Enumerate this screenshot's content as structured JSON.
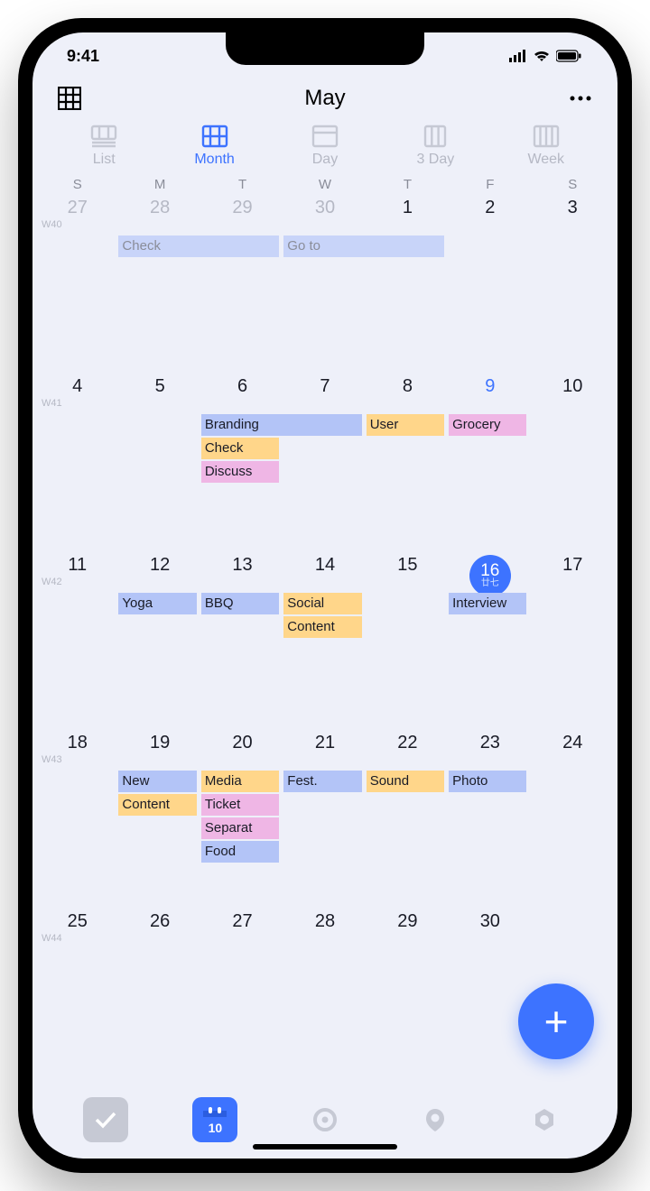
{
  "status": {
    "time": "9:41"
  },
  "header": {
    "title": "May"
  },
  "view_tabs": [
    {
      "label": "List",
      "active": false
    },
    {
      "label": "Month",
      "active": true
    },
    {
      "label": "Day",
      "active": false
    },
    {
      "label": "3 Day",
      "active": false
    },
    {
      "label": "Week",
      "active": false
    }
  ],
  "weekdays": [
    "S",
    "M",
    "T",
    "W",
    "T",
    "F",
    "S"
  ],
  "weeks": [
    {
      "wk": "W40",
      "dates": [
        {
          "num": "27",
          "dim": true
        },
        {
          "num": "28",
          "dim": true
        },
        {
          "num": "29",
          "dim": true
        },
        {
          "num": "30",
          "dim": true
        },
        {
          "num": "1"
        },
        {
          "num": "2"
        },
        {
          "num": "3"
        }
      ],
      "events": [
        {
          "label": "Check",
          "start": 1,
          "span": 2,
          "row": 0,
          "color": "lblue",
          "dim": true
        },
        {
          "label": "Go to",
          "start": 3,
          "span": 2,
          "row": 0,
          "color": "lblue",
          "dim": true
        }
      ]
    },
    {
      "wk": "W41",
      "dates": [
        {
          "num": "4"
        },
        {
          "num": "5"
        },
        {
          "num": "6"
        },
        {
          "num": "7"
        },
        {
          "num": "8"
        },
        {
          "num": "9",
          "today": true
        },
        {
          "num": "10"
        }
      ],
      "events": [
        {
          "label": "Branding",
          "start": 2,
          "span": 2,
          "row": 0,
          "color": "blue"
        },
        {
          "label": "User",
          "start": 4,
          "span": 1,
          "row": 0,
          "color": "yellow"
        },
        {
          "label": "Grocery",
          "start": 5,
          "span": 1,
          "row": 0,
          "color": "pink"
        },
        {
          "label": "Check",
          "start": 2,
          "span": 1,
          "row": 1,
          "color": "yellow"
        },
        {
          "label": "Discuss",
          "start": 2,
          "span": 1,
          "row": 2,
          "color": "pink"
        }
      ]
    },
    {
      "wk": "W42",
      "dates": [
        {
          "num": "11"
        },
        {
          "num": "12"
        },
        {
          "num": "13"
        },
        {
          "num": "14"
        },
        {
          "num": "15"
        },
        {
          "num": "16",
          "highlight": true,
          "sub": "廿七"
        },
        {
          "num": "17"
        }
      ],
      "events": [
        {
          "label": "Yoga",
          "start": 1,
          "span": 1,
          "row": 0,
          "color": "blue"
        },
        {
          "label": "BBQ",
          "start": 2,
          "span": 1,
          "row": 0,
          "color": "blue"
        },
        {
          "label": "Social",
          "start": 3,
          "span": 1,
          "row": 0,
          "color": "yellow"
        },
        {
          "label": "Interview",
          "start": 5,
          "span": 1,
          "row": 0,
          "color": "blue"
        },
        {
          "label": "Content",
          "start": 3,
          "span": 1,
          "row": 1,
          "color": "yellow"
        }
      ]
    },
    {
      "wk": "W43",
      "dates": [
        {
          "num": "18"
        },
        {
          "num": "19"
        },
        {
          "num": "20"
        },
        {
          "num": "21"
        },
        {
          "num": "22"
        },
        {
          "num": "23"
        },
        {
          "num": "24"
        }
      ],
      "events": [
        {
          "label": "New",
          "start": 1,
          "span": 1,
          "row": 0,
          "color": "blue"
        },
        {
          "label": "Media",
          "start": 2,
          "span": 1,
          "row": 0,
          "color": "yellow"
        },
        {
          "label": "Fest.",
          "start": 3,
          "span": 1,
          "row": 0,
          "color": "blue"
        },
        {
          "label": "Sound",
          "start": 4,
          "span": 1,
          "row": 0,
          "color": "yellow"
        },
        {
          "label": "Photo",
          "start": 5,
          "span": 1,
          "row": 0,
          "color": "blue"
        },
        {
          "label": "Content",
          "start": 1,
          "span": 1,
          "row": 1,
          "color": "yellow"
        },
        {
          "label": "Ticket",
          "start": 2,
          "span": 1,
          "row": 1,
          "color": "pink"
        },
        {
          "label": "Separat",
          "start": 2,
          "span": 1,
          "row": 2,
          "color": "pink"
        },
        {
          "label": "Food",
          "start": 2,
          "span": 1,
          "row": 3,
          "color": "blue"
        }
      ]
    },
    {
      "wk": "W44",
      "dates": [
        {
          "num": "25"
        },
        {
          "num": "26"
        },
        {
          "num": "27"
        },
        {
          "num": "28"
        },
        {
          "num": "29"
        },
        {
          "num": "30"
        },
        {
          "num": ""
        }
      ],
      "events": []
    }
  ],
  "nav": {
    "cal_day": "10"
  }
}
